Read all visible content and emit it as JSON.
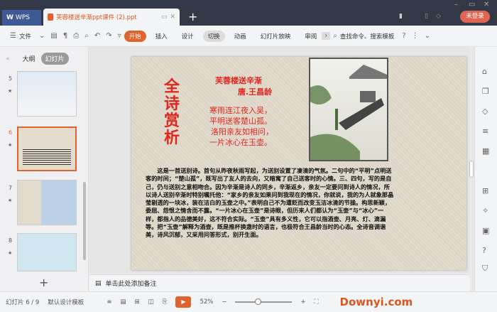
{
  "titlebar": {
    "wps_label": "WPS",
    "doc_tab": "芙蓉楼送辛渐ppt课件 (2).ppt",
    "login": "未登录"
  },
  "toolbar": {
    "file": "文件",
    "tabs": [
      "开始",
      "插入",
      "设计",
      "切换",
      "动画",
      "幻灯片放映",
      "审阅"
    ],
    "search": "查找命令、搜索模板",
    "help": "?"
  },
  "left_panel": {
    "tabs": [
      "大纲",
      "幻灯片"
    ],
    "slides": [
      "5",
      "6",
      "7",
      "8"
    ],
    "selected": "6"
  },
  "slide": {
    "vertical_title": "全诗赏析",
    "poem_title": "芙蓉楼送辛渐",
    "author": "唐.王昌龄",
    "poem_lines": [
      "寒雨连江夜入吴，",
      "平明送客楚山孤。",
      "洛阳亲友如相问，",
      "一片冰心在玉壶。"
    ],
    "body": "这是一首送别诗。首句从昨夜秋雨写起，为送别设置了凄清的气氛。二句中的“平明”点明送客的时间；“楚山孤”，既写出了友人的去向，又暗寓了自己送客时的心情。三、四句，写的是自己，仍与送别之意相吻合。因为辛渐是诗人的同乡，辛渐返乡，亲友一定要问到诗人的情况，所以诗人送别辛渐时特别嘱托他：“家乡的亲友如果问到我现在的情况，你就说，我的为人就象那晶莹剔透的一块冰，装在洁白的玉壶之中。”表明自己不为遭贬而改变玉洁冰清的节操。构思新颖，委屈、怨恨之情含而不露。“一片冰心在玉壶”是诗眼，但历来人们都认为“玉壶”与“冰心”一样，都指人的品德美好，这不符合实际。“玉壶”具有多义性，它可以指酒壶、月亮、灯、滴漏等。把“玉壶”解释为酒壶，既是推杯换盏时的语言，也极符合王昌龄当时的心态。全诗音调谐美，诗风沉郁，又采用问答形式，别开生面。"
  },
  "notes": {
    "placeholder": "单击此处添加备注"
  },
  "status": {
    "slide_count": "幻灯片 6 / 9",
    "template": "默认设计模板",
    "zoom": "52%",
    "watermark": "Downyi.com"
  }
}
